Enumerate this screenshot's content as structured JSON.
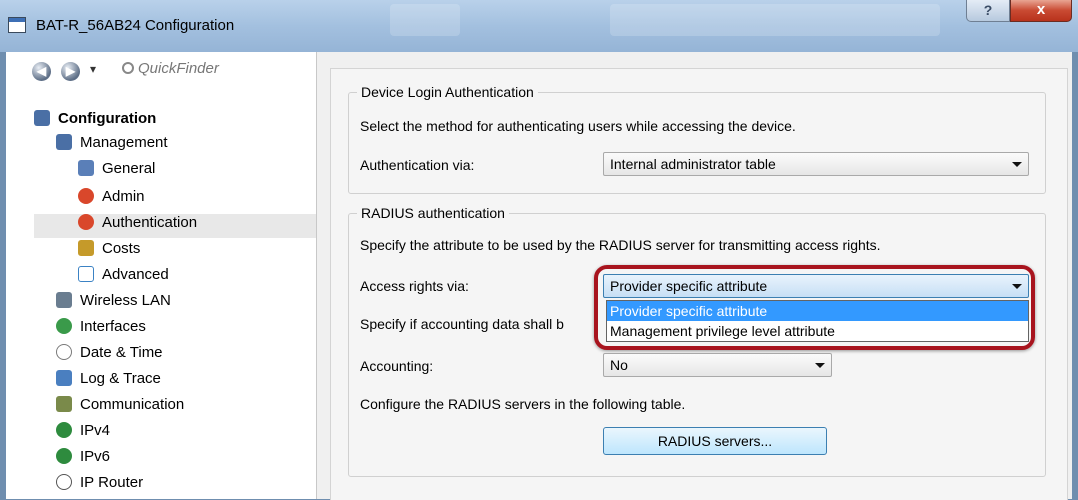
{
  "window": {
    "title": "BAT-R_56AB24 Configuration",
    "help_button": "?",
    "close_button": "x"
  },
  "nav": {
    "back": "◀",
    "forward": "▶",
    "dropdown": "▾",
    "quickfinder_placeholder": "QuickFinder"
  },
  "tree": {
    "root": "Configuration",
    "items": [
      {
        "label": "Management",
        "icon": "management-icon",
        "color": "#4a6fa5"
      },
      {
        "label": "General",
        "icon": "general-icon",
        "color": "#5a7fb8"
      },
      {
        "label": "Admin",
        "icon": "admin-icon",
        "color": "#d9472b"
      },
      {
        "label": "Authentication",
        "icon": "authentication-icon",
        "color": "#d9472b",
        "selected": true
      },
      {
        "label": "Costs",
        "icon": "costs-icon",
        "color": "#c59a2a"
      },
      {
        "label": "Advanced",
        "icon": "advanced-icon",
        "color": "#3b82c4"
      },
      {
        "label": "Wireless LAN",
        "icon": "wireless-lan-icon",
        "color": "#6a7d90"
      },
      {
        "label": "Interfaces",
        "icon": "interfaces-icon",
        "color": "#3a9a4a"
      },
      {
        "label": "Date & Time",
        "icon": "clock-icon",
        "color": "#7a7a7a"
      },
      {
        "label": "Log & Trace",
        "icon": "log-trace-icon",
        "color": "#4a7fc0"
      },
      {
        "label": "Communication",
        "icon": "communication-icon",
        "color": "#7a8a4a"
      },
      {
        "label": "IPv4",
        "icon": "ipv4-icon",
        "color": "#2e8b3e"
      },
      {
        "label": "IPv6",
        "icon": "ipv6-icon",
        "color": "#2e8b3e"
      },
      {
        "label": "IP Router",
        "icon": "ip-router-icon",
        "color": "#555555"
      }
    ]
  },
  "device_login": {
    "legend": "Device Login Authentication",
    "description": "Select the method for authenticating users while accessing the device.",
    "auth_label": "Authentication via:",
    "auth_value": "Internal administrator table"
  },
  "radius": {
    "legend": "RADIUS authentication",
    "description": "Specify the attribute to be used by the RADIUS server for transmitting access rights.",
    "access_label": "Access rights via:",
    "access_value": "Provider specific attribute",
    "access_options": [
      "Provider specific attribute",
      "Management privilege level attribute"
    ],
    "accounting_desc": "Specify if accounting data shall b",
    "accounting_label": "Accounting:",
    "accounting_value": "No",
    "servers_desc": "Configure the RADIUS servers in the following table.",
    "servers_button": "RADIUS servers..."
  },
  "colors": {
    "highlight_frame": "#a8141e",
    "selection": "#3399ff"
  }
}
